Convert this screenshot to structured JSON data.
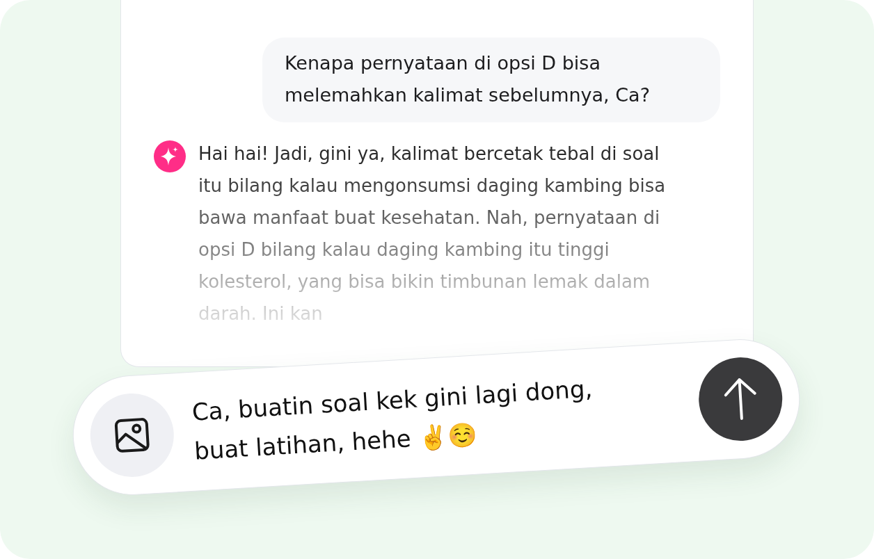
{
  "chat": {
    "messages": [
      {
        "kind": "user",
        "text": "Kenapa pernyataan di opsi D bisa melemahkan kalimat sebelumnya, Ca?"
      },
      {
        "kind": "assistant",
        "text": "Hai hai! Jadi, gini ya, kalimat bercetak tebal di soal itu bilang kalau mengonsumsi daging kambing bisa bawa manfaat buat kesehatan. Nah, pernyataan di opsi D bilang kalau daging kambing itu tinggi kolesterol, yang bisa bikin timbunan lemak dalam darah. Ini kan"
      }
    ]
  },
  "composer": {
    "value": "Ca, buatin soal kek gini lagi dong, buat latihan, hehe ✌️☺️"
  }
}
